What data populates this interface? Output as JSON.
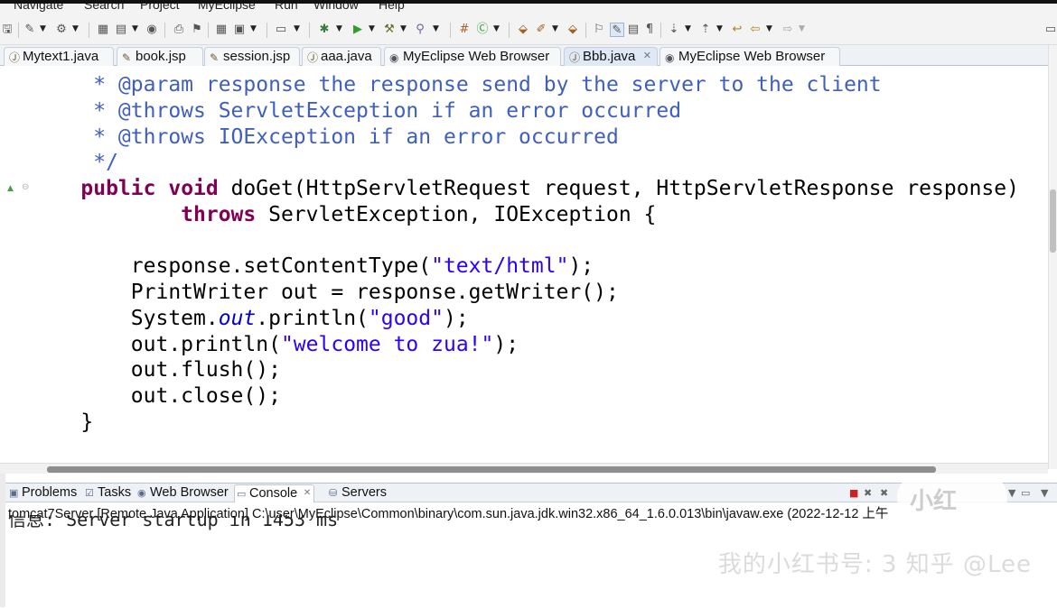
{
  "menu": {
    "items": [
      "Navigate",
      "Search",
      "Project",
      "MyEclipse",
      "Run",
      "Window",
      "Help"
    ]
  },
  "editor_tabs": [
    {
      "label": "Mytext1.java",
      "icon": "java-file-icon",
      "active": false
    },
    {
      "label": "book.jsp",
      "icon": "jsp-file-icon",
      "active": false
    },
    {
      "label": "session.jsp",
      "icon": "jsp-file-icon",
      "active": false
    },
    {
      "label": "aaa.java",
      "icon": "java-file-icon",
      "active": false
    },
    {
      "label": "MyEclipse Web Browser",
      "icon": "globe-icon",
      "active": false
    },
    {
      "label": "Bbb.java",
      "icon": "java-file-icon",
      "active": true,
      "close": "✕"
    },
    {
      "label": "MyEclipse Web Browser",
      "icon": "globe-icon",
      "active": false
    }
  ],
  "code": {
    "lines": [
      [
        {
          "c": "cm",
          "t": "     * "
        },
        {
          "c": "cm",
          "t": "@param"
        },
        {
          "c": "cm",
          "t": " response the response send by the server to the client"
        }
      ],
      [
        {
          "c": "cm",
          "t": "     * @throws ServletException if an error occurred"
        }
      ],
      [
        {
          "c": "cm",
          "t": "     * @throws IOException if an error occurred"
        }
      ],
      [
        {
          "c": "cm",
          "t": "     */"
        }
      ],
      [
        {
          "c": "pl",
          "t": "    "
        },
        {
          "c": "kw",
          "t": "public"
        },
        {
          "c": "pl",
          "t": " "
        },
        {
          "c": "kw",
          "t": "void"
        },
        {
          "c": "pl",
          "t": " doGet(HttpServletRequest request, HttpServletResponse response)"
        }
      ],
      [
        {
          "c": "pl",
          "t": "            "
        },
        {
          "c": "kw",
          "t": "throws"
        },
        {
          "c": "pl",
          "t": " ServletException, IOException {"
        }
      ],
      [
        {
          "c": "pl",
          "t": ""
        }
      ],
      [
        {
          "c": "pl",
          "t": "        response.setContentType("
        },
        {
          "c": "str",
          "t": "\"text/html\""
        },
        {
          "c": "pl",
          "t": ");"
        }
      ],
      [
        {
          "c": "pl",
          "t": "        PrintWriter out = response.getWriter();"
        }
      ],
      [
        {
          "c": "pl",
          "t": "        System."
        },
        {
          "c": "fld",
          "t": "out"
        },
        {
          "c": "pl",
          "t": ".println("
        },
        {
          "c": "str",
          "t": "\"good\""
        },
        {
          "c": "pl",
          "t": ");"
        }
      ],
      [
        {
          "c": "pl",
          "t": "        out.println("
        },
        {
          "c": "str",
          "t": "\"welcome to zua!\""
        },
        {
          "c": "pl",
          "t": ");"
        }
      ],
      [
        {
          "c": "pl",
          "t": "        out.flush();"
        }
      ],
      [
        {
          "c": "pl",
          "t": "        out.close();"
        }
      ],
      [
        {
          "c": "pl",
          "t": "    }"
        }
      ]
    ]
  },
  "panel_tabs": [
    {
      "label": "Problems",
      "icon": "problems-icon",
      "active": false
    },
    {
      "label": "Tasks",
      "icon": "tasks-icon",
      "active": false
    },
    {
      "label": "Web Browser",
      "icon": "globe-icon",
      "active": false
    },
    {
      "label": "Console",
      "icon": "console-icon",
      "active": true,
      "close": "✕"
    },
    {
      "label": "Servers",
      "icon": "servers-icon",
      "active": false
    }
  ],
  "console": {
    "title": "tomcat7Server [Remote Java Application] C:\\user\\MyEclipse\\Common\\binary\\com.sun.java.jdk.win32.x86_64_1.6.0.013\\bin\\javaw.exe (2022-12-12 上午",
    "output": "信息: Server startup in 1453 ms"
  },
  "watermark": {
    "text": "我的小红书号: 3  知乎 @Lee"
  },
  "colors": {
    "comment": "#3f5fbf",
    "keyword": "#7f0055",
    "string": "#2a00ff",
    "field": "#0000c0"
  }
}
